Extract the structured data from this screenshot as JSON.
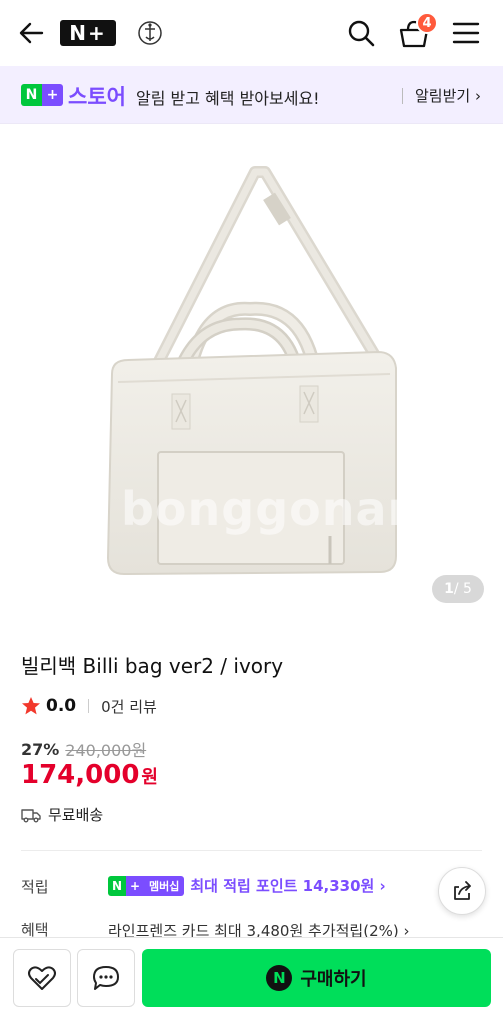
{
  "header": {
    "logo_text": "N+",
    "cart_count": "4",
    "icons": [
      "back-arrow-icon",
      "brand-emblem-icon",
      "search-icon",
      "cart-icon",
      "hamburger-menu-icon"
    ]
  },
  "store_banner": {
    "n_glyph": "N",
    "plus_glyph": "+",
    "store_word": "스토어",
    "message": "알림 받고 혜택 받아보세요!",
    "notify_label": "알림받기 ›"
  },
  "gallery": {
    "watermark": "bonggonam",
    "current": "1",
    "total": " / 5"
  },
  "product": {
    "title": "빌리백 Billi bag ver2 / ivory",
    "rating": "0.0",
    "reviews": "0건 리뷰",
    "discount_pct": "27%",
    "original_price": "240,000원",
    "price": "174,000",
    "price_unit": "원",
    "shipping": "무료배송"
  },
  "points": {
    "label": "적립",
    "membership_tag": "멤버십",
    "text": "최대 적립 포인트 14,330원 ›"
  },
  "benefit": {
    "label": "혜택",
    "text": "라인프렌즈 카드 최대 3,480원 추가적립(2%) ›"
  },
  "bottom_bar": {
    "npay_glyph": "N",
    "buy_label": "구매하기"
  },
  "colors": {
    "accent_purple": "#7b4dff",
    "naver_green": "#00c73c",
    "buy_green": "#00de5a",
    "price_red": "#e4002b"
  }
}
